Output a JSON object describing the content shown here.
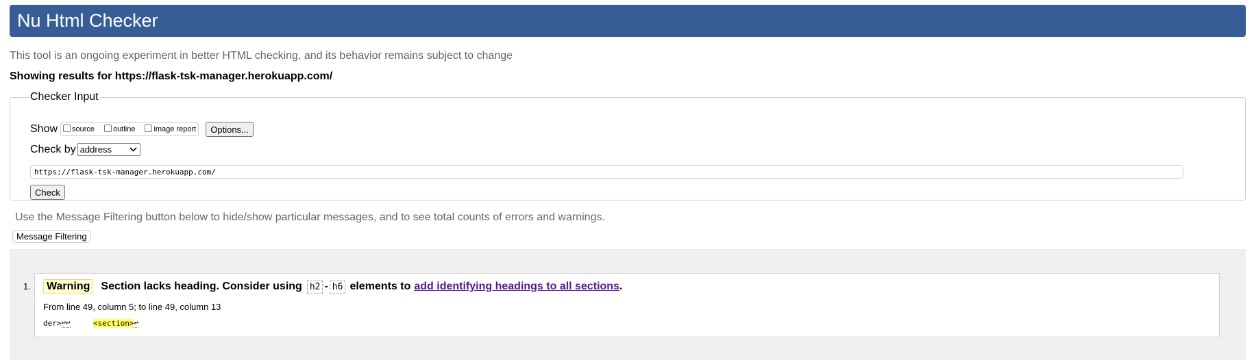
{
  "header": {
    "title": "Nu Html Checker"
  },
  "tagline": "This tool is an ongoing experiment in better HTML checking, and its behavior remains subject to change",
  "results_for": "Showing results for https://flask-tsk-manager.herokuapp.com/",
  "checker_input": {
    "legend": "Checker Input",
    "show_label": "Show",
    "options": [
      {
        "label": "source",
        "checked": false
      },
      {
        "label": "outline",
        "checked": false
      },
      {
        "label": "image report",
        "checked": false
      }
    ],
    "options_button": "Options...",
    "check_by_label": "Check by",
    "check_by_selected": "address",
    "url_value": "https://flask-tsk-manager.herokuapp.com/",
    "check_button": "Check"
  },
  "filter_help": "Use the Message Filtering button below to hide/show particular messages, and to see total counts of errors and warnings.",
  "filter_button": "Message Filtering",
  "messages": [
    {
      "number": "1.",
      "type": "Warning",
      "text_before": "Section lacks heading. Consider using",
      "code_start": "h2",
      "dash": "-",
      "code_end": "h6",
      "text_middle": "elements to",
      "link_text": "add identifying headings to all sections",
      "text_after": ".",
      "location": "From line 49, column 5; to line 49, column 13",
      "extract_before": "der>",
      "extract_returns_1": "↩↩",
      "extract_gap": "     ",
      "extract_highlight": "<section>",
      "extract_returns_2": "↩"
    }
  ],
  "colors": {
    "header_bg": "#365d95",
    "warning_badge_bg": "#ffffcc",
    "highlight": "#ffff66",
    "link": "#551a8b",
    "results_bg": "#efefef"
  }
}
